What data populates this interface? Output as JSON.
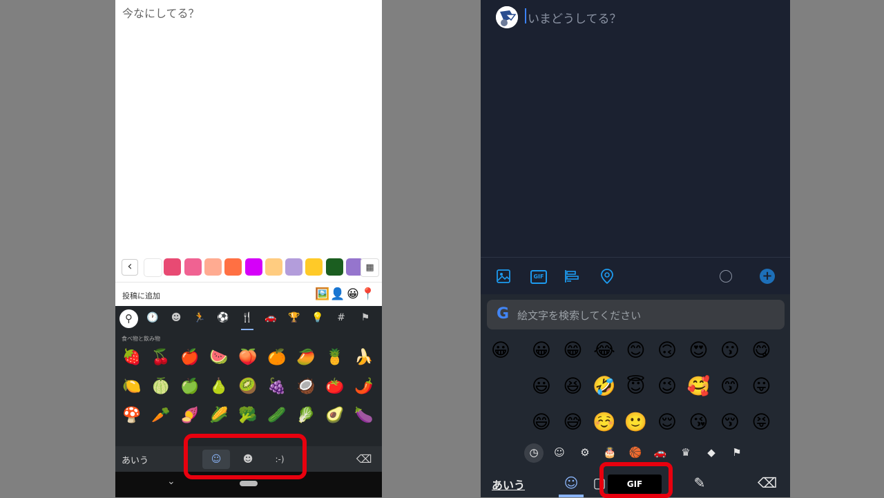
{
  "left": {
    "compose_placeholder": "今なにしてる？",
    "sticker_back_icon": "‹",
    "stickers": [
      "#ffffff",
      "#e84a73",
      "#f06292",
      "#ffab91",
      "#ff7043",
      "#d500f9",
      "#ffcc80",
      "#b39ddb",
      "#ffca28",
      "#1b5e20",
      "#9575cd"
    ],
    "add_to_post_label": "投稿に追加",
    "add_icons": [
      "🖼️",
      "👤",
      "😀",
      "📍"
    ],
    "category_icons": [
      "🕐",
      "☻",
      "🏃",
      "⚽",
      "🍴",
      "🚗",
      "🏆",
      "💡",
      "#",
      "⚑"
    ],
    "section_label": "食べ物と飲み物",
    "emoji_rows": [
      [
        "🍓",
        "🍒",
        "🍎",
        "🍉",
        "🍑",
        "🍊",
        "🥭",
        "🍍",
        "🍌"
      ],
      [
        "🍋",
        "🍈",
        "🍏",
        "🍐",
        "🥝",
        "🍇",
        "🥥",
        "🍅",
        "🌶️"
      ],
      [
        "🍄",
        "🥕",
        "🍠",
        "🌽",
        "🥦",
        "🥒",
        "🥬",
        "🥑",
        "🍆"
      ]
    ],
    "keyboard_lang": "あいう",
    "tabs": [
      "☺",
      "☻",
      ":-)"
    ],
    "backspace_icon": "⌫",
    "nav_chevron": "⌄"
  },
  "right": {
    "compose_placeholder": "いまどうしてる？",
    "toolbar": {
      "image_icon": "🖼",
      "gif_label": "GIF",
      "poll_icon": "≡",
      "location_icon": "⌾",
      "add_icon": "+"
    },
    "search_g": "G",
    "search_placeholder": "絵文字を検索してください",
    "recent_emoji": "😀",
    "emoji_rows": [
      [
        "😀",
        "😁",
        "😂",
        "😊",
        "🙃",
        "😍",
        "😗",
        "😋"
      ],
      [
        "😃",
        "😆",
        "🤣",
        "😇",
        "😉",
        "🥰",
        "😙",
        "😛"
      ],
      [
        "😄",
        "😅",
        "☺️",
        "🙂",
        "😌",
        "😘",
        "😚",
        "😝"
      ]
    ],
    "category_icons": [
      "☺",
      "⚙",
      "🎂",
      "🏀",
      "🚗",
      "♛",
      "◆",
      "⚑"
    ],
    "keyboard_lang": "あいう",
    "gif_button": "GIF",
    "bottom_icons": [
      "☺",
      "▢",
      "✎",
      "⌫"
    ]
  },
  "colors": {
    "highlight_red": "#e8000e",
    "twitter_blue": "#1d9bf0"
  }
}
